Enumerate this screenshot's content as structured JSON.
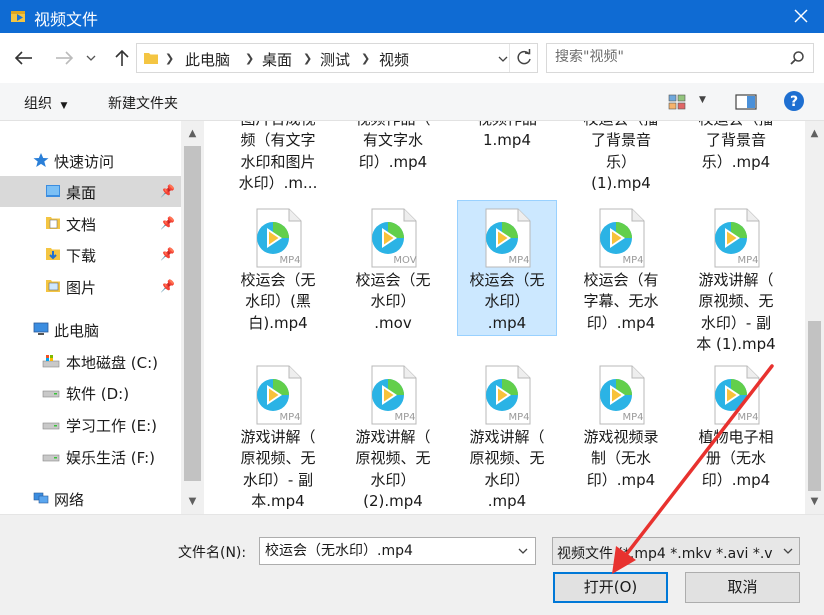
{
  "window": {
    "title": "视频文件"
  },
  "breadcrumb": [
    "此电脑",
    "桌面",
    "测试",
    "视频"
  ],
  "search": {
    "placeholder": "搜索\"视频\""
  },
  "commandbar": {
    "organize": "组织",
    "new_folder": "新建文件夹"
  },
  "nav": {
    "items": [
      {
        "label": "快速访问"
      },
      {
        "label": "桌面"
      },
      {
        "label": "文档"
      },
      {
        "label": "下载"
      },
      {
        "label": "图片"
      },
      {
        "label": "此电脑"
      },
      {
        "label": "本地磁盘 (C:)"
      },
      {
        "label": "软件 (D:)"
      },
      {
        "label": "学习工作 (E:)"
      },
      {
        "label": "娱乐生活 (F:)"
      },
      {
        "label": "网络"
      }
    ]
  },
  "files": {
    "row0": [
      {
        "name": "图片合成视\n频（有文字\n水印和图片\n水印）.m..."
      },
      {
        "name": "视频作品（\n有文字水\n印）.mp4"
      },
      {
        "name": "视频作品\n1.mp4"
      },
      {
        "name": "校运会（播\n了背景音\n乐）\n(1).mp4"
      },
      {
        "name": "校运会（播\n了背景音\n乐）.mp4"
      }
    ],
    "row1": [
      {
        "name": "校运会（无\n水印）(黑\n白).mp4",
        "ext": "MP4"
      },
      {
        "name": "校运会（无\n水印）\n.mov",
        "ext": "MOV"
      },
      {
        "name": "校运会（无\n水印）\n.mp4",
        "ext": "MP4"
      },
      {
        "name": "校运会（有\n字幕、无水\n印）.mp4",
        "ext": "MP4"
      },
      {
        "name": "游戏讲解（\n原视频、无\n水印）- 副\n本 (1).mp4",
        "ext": "MP4"
      }
    ],
    "row2": [
      {
        "name": "游戏讲解（\n原视频、无\n水印）- 副\n本.mp4",
        "ext": "MP4"
      },
      {
        "name": "游戏讲解（\n原视频、无\n水印）\n(2).mp4",
        "ext": "MP4"
      },
      {
        "name": "游戏讲解（\n原视频、无\n水印）\n.mp4",
        "ext": "MP4"
      },
      {
        "name": "游戏视频录\n制（无水\n印）.mp4",
        "ext": "MP4"
      },
      {
        "name": "植物电子相\n册（无水\n印）.mp4",
        "ext": "MP4"
      }
    ]
  },
  "footer": {
    "filename_label": "文件名(N):",
    "filename_value": "校运会（无水印）.mp4",
    "filter_value": "视频文件 (*.mp4 *.mkv *.avi *.v",
    "open_label": "打开(O)",
    "cancel_label": "取消"
  },
  "colors": {
    "titlebar": "#0f6bd3",
    "selection": "#cce8ff",
    "arrow": "#e8322f",
    "accent": "#0078d7"
  }
}
